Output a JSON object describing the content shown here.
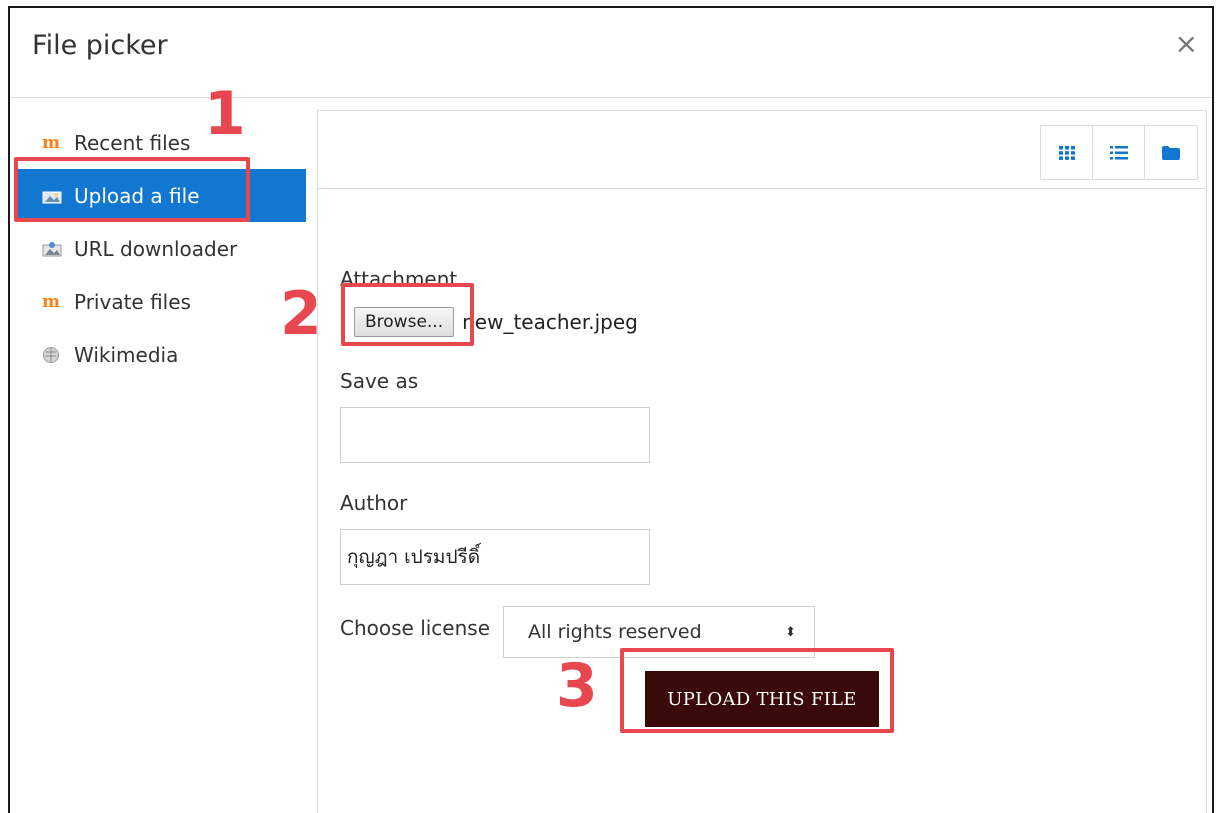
{
  "dialog": {
    "title": "File picker",
    "close_icon": "×"
  },
  "sidebar": {
    "items": [
      {
        "label": "Recent files",
        "icon": "moodle-icon",
        "active": false
      },
      {
        "label": "Upload a file",
        "icon": "upload-icon",
        "active": true
      },
      {
        "label": "URL downloader",
        "icon": "url-download-icon",
        "active": false
      },
      {
        "label": "Private files",
        "icon": "moodle-icon",
        "active": false
      },
      {
        "label": "Wikimedia",
        "icon": "wikimedia-icon",
        "active": false
      }
    ]
  },
  "toolbar": {
    "views": [
      "grid-view-icon",
      "list-view-icon",
      "folder-view-icon"
    ]
  },
  "form": {
    "attachment_label": "Attachment",
    "browse_label": "Browse...",
    "filename": "new_teacher.jpeg",
    "save_as_label": "Save as",
    "save_as_value": "",
    "author_label": "Author",
    "author_value": "กุญฎา เปรมปรีดิ์",
    "license_label": "Choose license",
    "license_value": "All rights reserved",
    "upload_button": "UPLOAD THIS FILE"
  },
  "annotations": {
    "step1": "1",
    "step2": "2",
    "step3": "3",
    "color": "#e8474f"
  },
  "colors": {
    "accent": "#1177d1",
    "upload_button_bg": "#3a0a0a"
  }
}
